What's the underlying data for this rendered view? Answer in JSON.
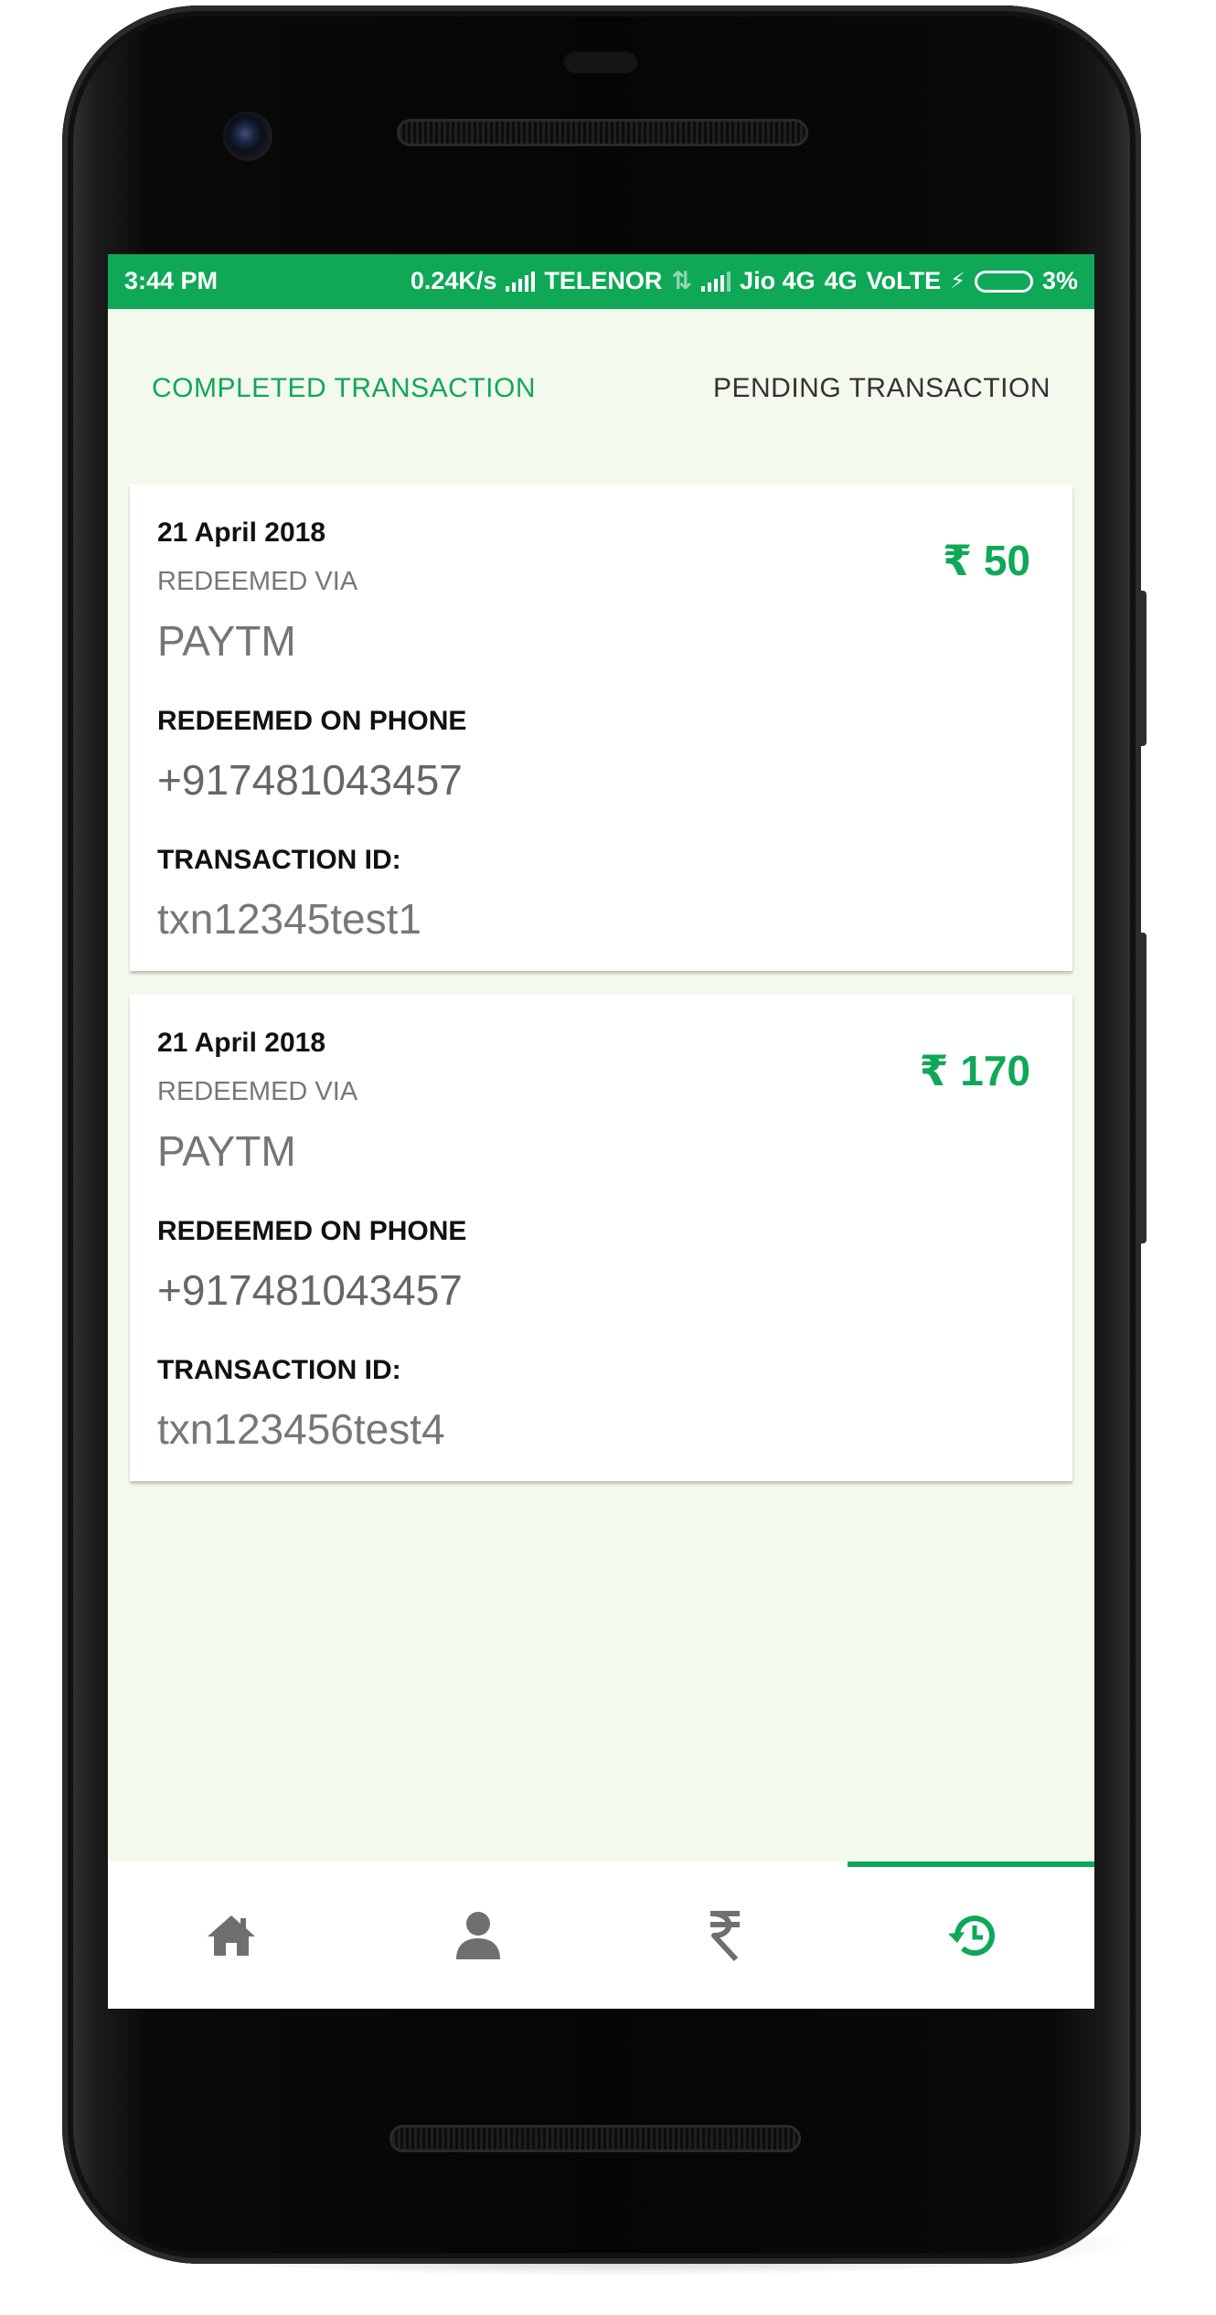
{
  "status_bar": {
    "time": "3:44 PM",
    "speed": "0.24K/s",
    "carrier1": "TELENOR",
    "carrier2": "Jio 4G",
    "network": "4G",
    "volte": "VoLTE",
    "battery": "3%"
  },
  "tabs": [
    {
      "label": "COMPLETED TRANSACTION",
      "active": true
    },
    {
      "label": "PENDING TRANSACTION",
      "active": false
    }
  ],
  "transactions": [
    {
      "date": "21 April 2018",
      "via_label": "REDEEMED VIA",
      "via": "PAYTM",
      "amount": "₹ 50",
      "phone_label": "REDEEMED ON PHONE",
      "phone": "+917481043457",
      "txn_label": "TRANSACTION ID:",
      "txn_id": "txn12345test1"
    },
    {
      "date": "21 April 2018",
      "via_label": "REDEEMED VIA",
      "via": "PAYTM",
      "amount": "₹ 170",
      "phone_label": "REDEEMED ON PHONE",
      "phone": "+917481043457",
      "txn_label": "TRANSACTION ID:",
      "txn_id": "txn123456test4"
    }
  ],
  "bottom_nav": [
    {
      "icon": "home-icon",
      "active": false
    },
    {
      "icon": "profile-icon",
      "active": false
    },
    {
      "icon": "rupee-icon",
      "active": false
    },
    {
      "icon": "history-icon",
      "active": true
    }
  ],
  "colors": {
    "accent": "#0fa857",
    "background": "#f4f9ee",
    "inactive_icon": "#6f6f6f"
  }
}
